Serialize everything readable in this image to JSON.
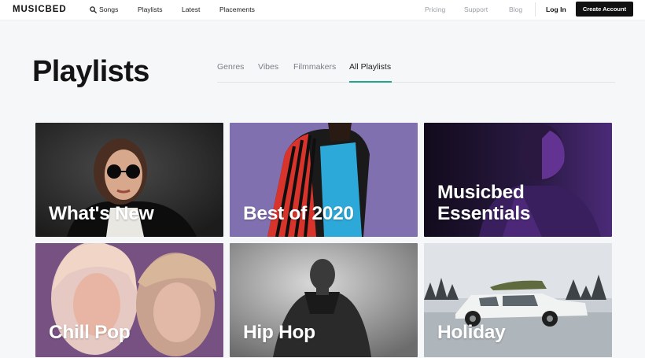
{
  "brand": {
    "logo": "MUSICBED"
  },
  "nav": {
    "songs": "Songs",
    "playlists": "Playlists",
    "latest": "Latest",
    "placements": "Placements",
    "pricing": "Pricing",
    "support": "Support",
    "blog": "Blog",
    "login": "Log In",
    "create_account": "Create Account"
  },
  "page": {
    "title": "Playlists",
    "tabs": [
      {
        "label": "Genres"
      },
      {
        "label": "Vibes"
      },
      {
        "label": "Filmmakers"
      },
      {
        "label": "All Playlists",
        "active": true
      }
    ]
  },
  "playlists": [
    {
      "title": "What's New"
    },
    {
      "title": "Best of 2020"
    },
    {
      "title": "Musicbed Essentials"
    },
    {
      "title": "Chill Pop"
    },
    {
      "title": "Hip Hop"
    },
    {
      "title": "Holiday"
    }
  ],
  "colors": {
    "accent": "#22a58b",
    "button": "#111111"
  },
  "icons": {
    "search": "search-icon"
  }
}
